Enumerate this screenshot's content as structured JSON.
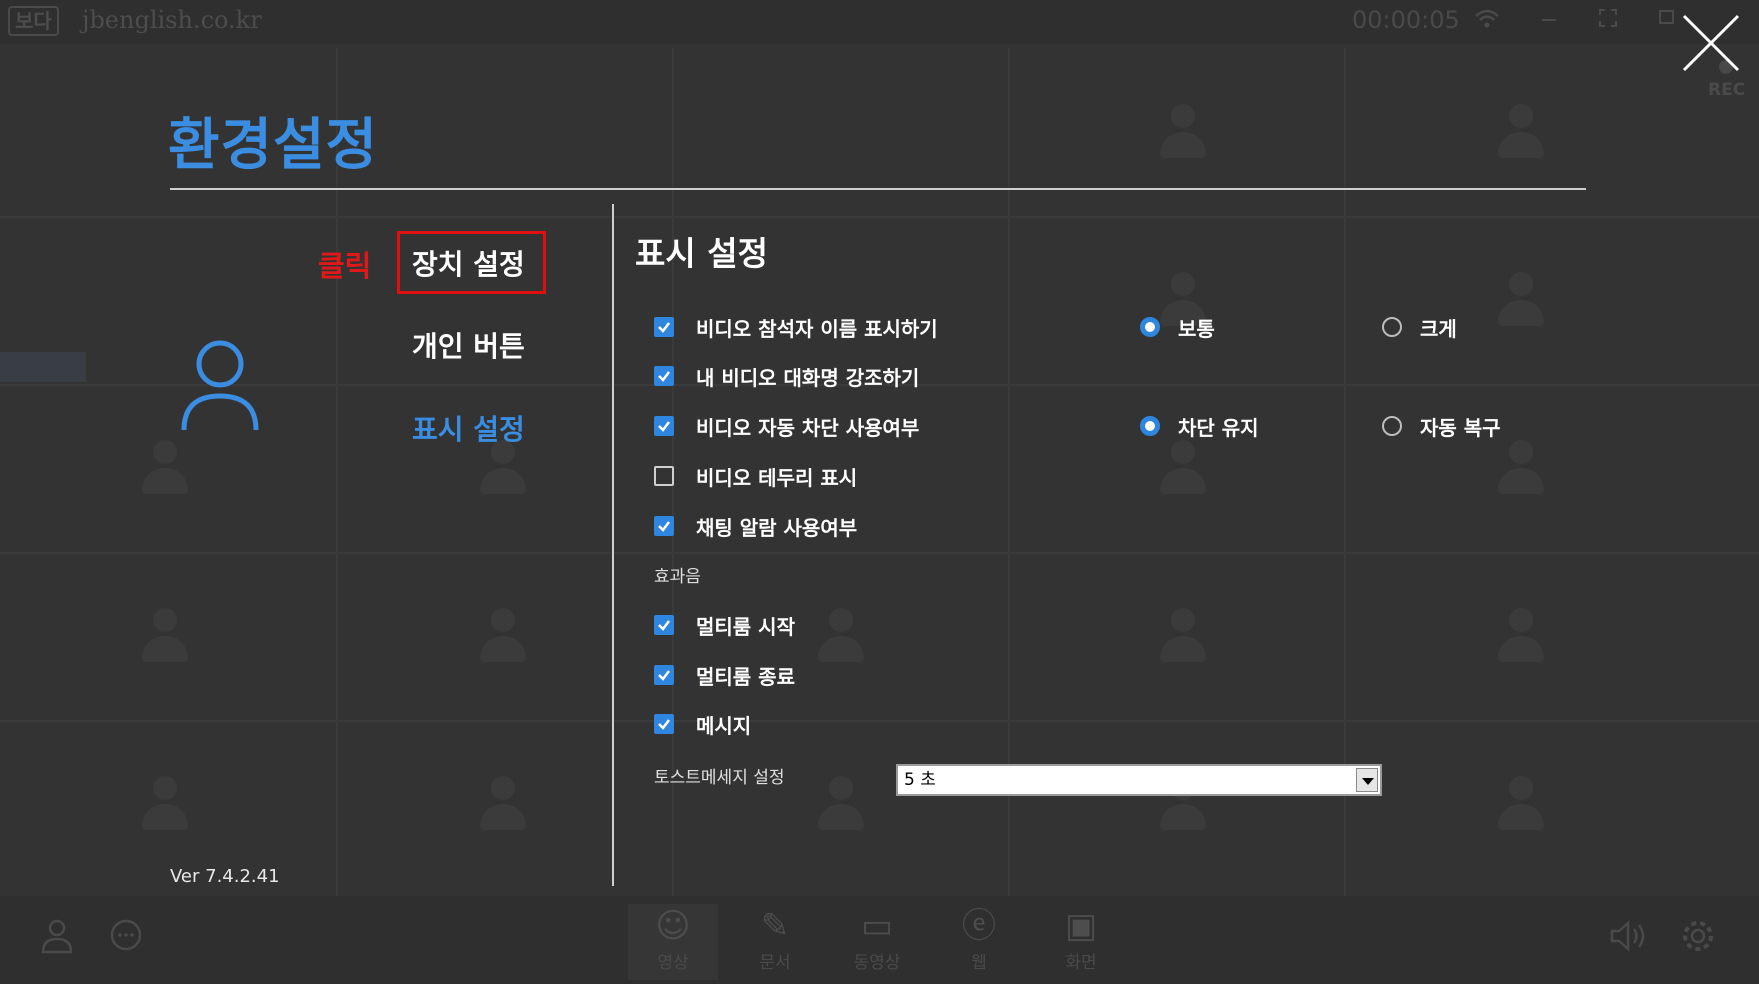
{
  "topbar": {
    "logo": "보다",
    "domain": "jbenglish.co.kr",
    "timer": "00:00:05",
    "rec": "REC"
  },
  "settings": {
    "title": "환경설정",
    "click_label": "클릭",
    "menu": [
      {
        "label": "장치 설정"
      },
      {
        "label": "개인 버튼"
      },
      {
        "label": "표시 설정"
      }
    ],
    "version": "Ver 7.4.2.41"
  },
  "display": {
    "title": "표시 설정",
    "options": [
      {
        "label": "비디오 참석자 이름 표시하기",
        "checked": true
      },
      {
        "label": "내 비디오 대화명 강조하기",
        "checked": true
      },
      {
        "label": "비디오 자동 차단 사용여부",
        "checked": true
      },
      {
        "label": "비디오 테두리 표시",
        "checked": false
      },
      {
        "label": "채팅 알람 사용여부",
        "checked": true
      }
    ],
    "name_size_radios": [
      {
        "label": "보통",
        "selected": true
      },
      {
        "label": "크게",
        "selected": false
      }
    ],
    "block_radios": [
      {
        "label": "차단 유지",
        "selected": true
      },
      {
        "label": "자동 복구",
        "selected": false
      }
    ],
    "sound_group_label": "효과음",
    "sounds": [
      {
        "label": "멀티룸 시작",
        "checked": true
      },
      {
        "label": "멀티룸 종료",
        "checked": true
      },
      {
        "label": "메시지",
        "checked": true
      }
    ],
    "toast_label": "토스트메세지 설정",
    "toast_value": "5 초"
  },
  "toolbar": {
    "tools": [
      {
        "label": "영상",
        "icon": "smile-icon"
      },
      {
        "label": "문서",
        "icon": "document-icon"
      },
      {
        "label": "동영상",
        "icon": "video-icon"
      },
      {
        "label": "웹",
        "icon": "web-icon"
      },
      {
        "label": "화면",
        "icon": "screen-share-icon"
      }
    ]
  },
  "colors": {
    "accent": "#3a8de0",
    "checkbox": "#2e86de",
    "highlight": "#e01010",
    "background": "#333333"
  }
}
